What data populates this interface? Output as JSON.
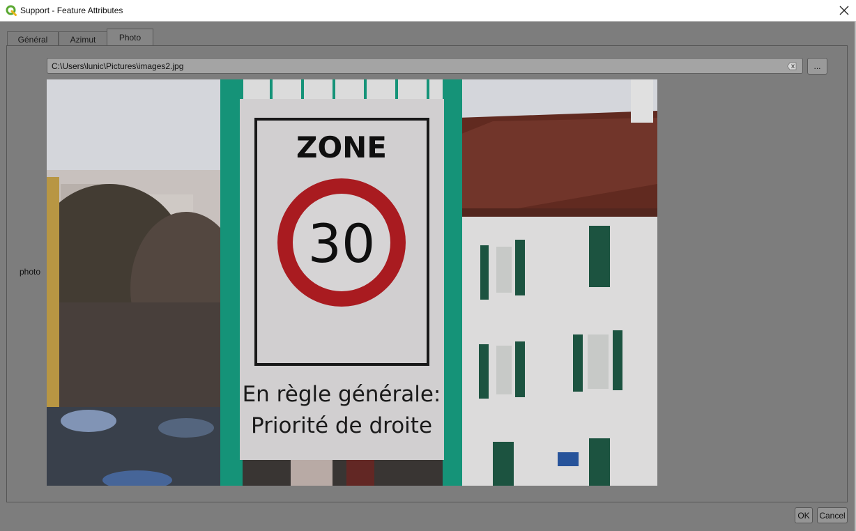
{
  "window": {
    "title": "Support - Feature Attributes"
  },
  "tabs": [
    {
      "label": "Général"
    },
    {
      "label": "Azimut"
    },
    {
      "label": "Photo"
    }
  ],
  "field": {
    "label": "photo",
    "path": "C:\\Users\\lunic\\Pictures\\images2.jpg",
    "browse_label": "..."
  },
  "sign": {
    "zone": "ZONE",
    "speed": "30",
    "line1": "En règle générale:",
    "line2": "Priorité de droite"
  },
  "buttons": {
    "ok": "OK",
    "cancel": "Cancel"
  },
  "colors": {
    "accent": "#2e9f3a",
    "sign_red": "#b81d24",
    "pole_green": "#17a083"
  }
}
